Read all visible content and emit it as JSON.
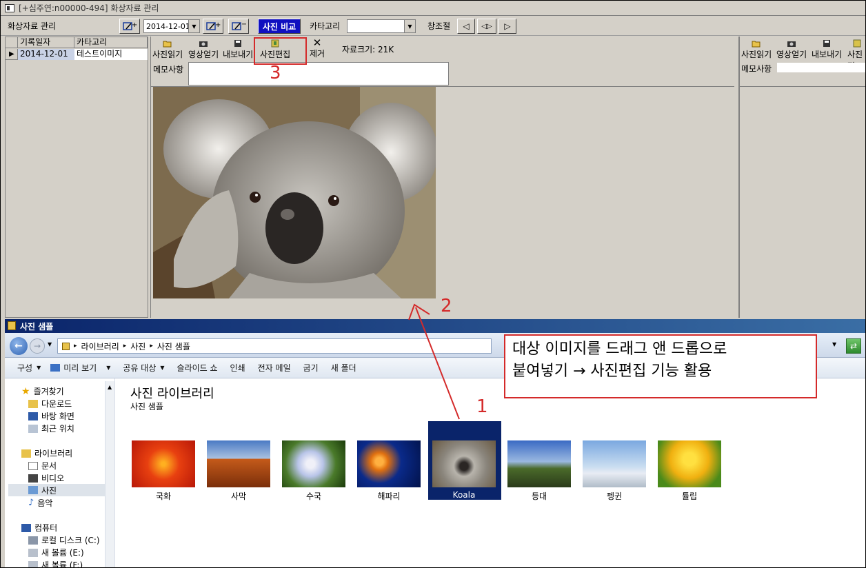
{
  "window": {
    "title": "[+심주연:n00000-494] 화상자료 관리"
  },
  "toolbar": {
    "section_label": "화상자료 관리",
    "date_value": "2014-12-01",
    "compare_label": "사진 비교",
    "category_label": "카타고리",
    "category_value": "",
    "adjust_label": "창조절"
  },
  "grid": {
    "columns": [
      "기록일자",
      "카타고리"
    ],
    "rows": [
      [
        "2014-12-01",
        "테스트이미지"
      ]
    ]
  },
  "center": {
    "tools": [
      "사진읽기",
      "영상얻기",
      "내보내기",
      "사진편집",
      "제거"
    ],
    "file_size": "자료크기: 21K",
    "memo_label": "메모사항"
  },
  "right_panel": {
    "tools": [
      "사진읽기",
      "영상얻기",
      "내보내기",
      "사진편"
    ],
    "memo_label": "메모사항"
  },
  "explorer": {
    "title": "사진 샘플",
    "breadcrumb": [
      "라이브러리",
      "사진",
      "사진 샘플"
    ],
    "commands": [
      "구성",
      "미리 보기",
      "공유 대상",
      "슬라이드 쇼",
      "인쇄",
      "전자 메일",
      "굽기",
      "새 폴더"
    ],
    "nav": {
      "favorites": "즐겨찾기",
      "fav_items": [
        "다운로드",
        "바탕 화면",
        "최근 위치"
      ],
      "libraries": "라이브러리",
      "lib_items": [
        "문서",
        "비디오",
        "사진",
        "음악"
      ],
      "computer": "컴퓨터",
      "comp_items": [
        "로컬 디스크 (C:)",
        "새 볼륨 (E:)",
        "새 볼륨 (F:)"
      ]
    },
    "library_title": "사진 라이브러리",
    "library_subtitle": "사진 샘플",
    "thumbnails": [
      "국화",
      "사막",
      "수국",
      "해파리",
      "Koala",
      "등대",
      "펭귄",
      "튤립"
    ]
  },
  "annotations": {
    "step1": "1",
    "step2": "2",
    "step3": "3",
    "callout_line1": "대상 이미지를 드래그 앤 드롭으로",
    "callout_line2": "붙여넣기 → 사진편집 기능 활용"
  },
  "colors": {
    "accent_red": "#d42a2a",
    "selection_blue": "#0a246a",
    "compare_bg": "#1010c0"
  }
}
